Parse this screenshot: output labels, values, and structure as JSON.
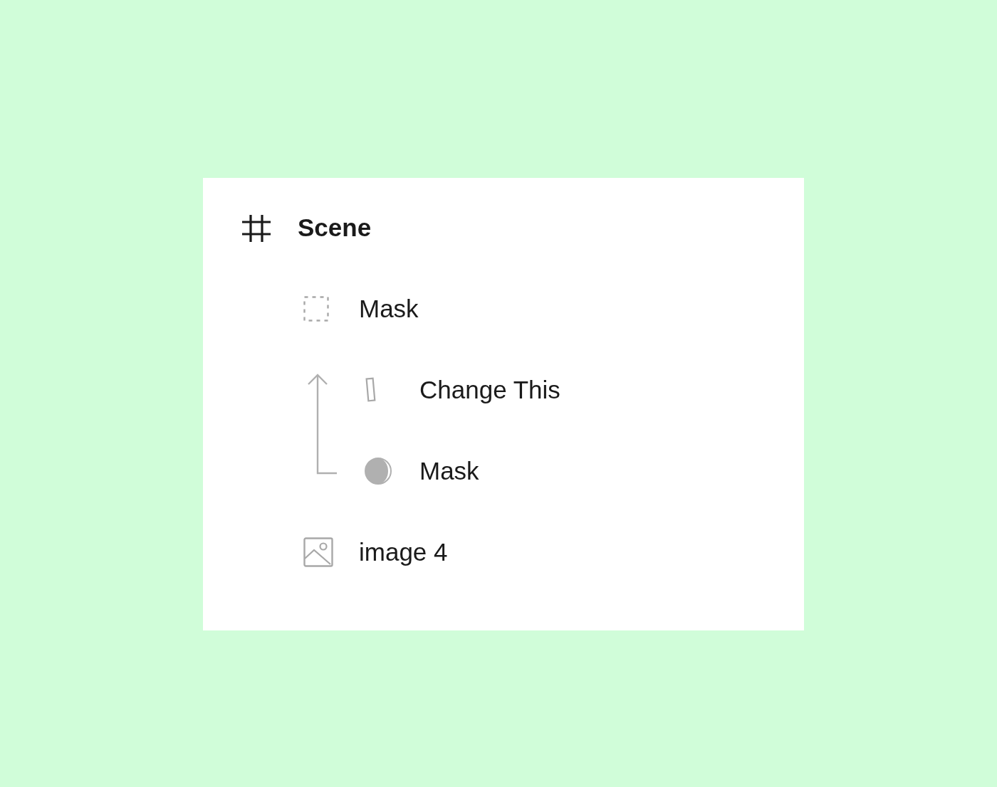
{
  "layers": [
    {
      "name": "Scene",
      "kind": "frame",
      "children": [
        {
          "name": "Mask",
          "kind": "mask-group",
          "children": [
            {
              "name": "Change This",
              "kind": "rectangle"
            },
            {
              "name": "Mask",
              "kind": "mask"
            }
          ]
        },
        {
          "name": "image 4",
          "kind": "image"
        }
      ]
    }
  ]
}
